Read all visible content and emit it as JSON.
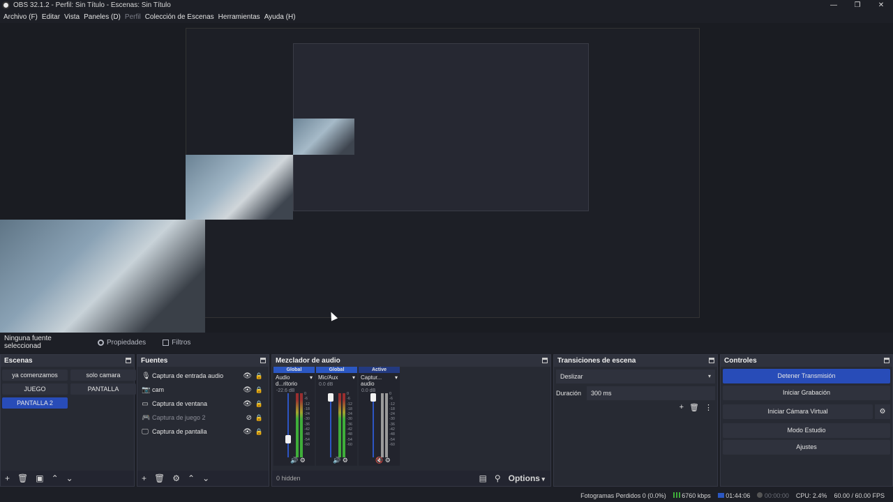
{
  "window": {
    "title": "OBS 32.1.2 - Perfil: Sin Título - Escenas: Sin Título",
    "min": "—",
    "max": "❐",
    "close": "✕"
  },
  "menu": [
    "Archivo (F)",
    "Editar",
    "Vista",
    "Paneles (D)",
    "Perfil",
    "Colección de Escenas",
    "Herramientas",
    "Ayuda (H)"
  ],
  "propbar": {
    "no_source": "Ninguna fuente seleccionad",
    "properties": "Propiedades",
    "filters": "Filtros"
  },
  "scenes": {
    "title": "Escenas",
    "items": [
      "ya comenzamos",
      "solo camara",
      "JUEGO",
      "PANTALLA",
      "PANTALLA 2"
    ],
    "active": "PANTALLA 2"
  },
  "sources": {
    "title": "Fuentes",
    "items": [
      {
        "label": "Captura de entrada audio",
        "icon": "mic-icon"
      },
      {
        "label": "cam",
        "icon": "camera-icon"
      },
      {
        "label": "Captura de ventana",
        "icon": "window-icon"
      },
      {
        "label": "Captura de juego 2",
        "icon": "gamepad-icon",
        "hidden": true
      },
      {
        "label": "Captura de pantalla",
        "icon": "monitor-icon"
      }
    ]
  },
  "mixer": {
    "title": "Mezclador de audio",
    "hidden": "0 hidden",
    "options": "Options",
    "channels": [
      {
        "tag": "Global",
        "name": "Audio d...ritorio",
        "db": "-22.6 dB"
      },
      {
        "tag": "Global",
        "name": "Mic/Aux",
        "db": "0.0 dB"
      },
      {
        "tag": "Active",
        "name": "Captur... audio",
        "db": "0.0 dB"
      }
    ],
    "scale": [
      "0",
      "-6",
      "-12",
      "-18",
      "-24",
      "-30",
      "-36",
      "-42",
      "-48",
      "-54",
      "-60"
    ]
  },
  "transitions": {
    "title": "Transiciones de escena",
    "selected": "Deslizar",
    "duration_label": "Duración",
    "duration": "300 ms"
  },
  "controls": {
    "title": "Controles",
    "stop_stream": "Detener Transmisión",
    "start_record": "Iniciar Grabación",
    "virtual_cam": "Iniciar Cámara Virtual",
    "studio_mode": "Modo Estudio",
    "settings": "Ajustes"
  },
  "status": {
    "dropped": "Fotogramas Perdidos 0 (0.0%)",
    "bitrate": "6760 kbps",
    "live_time": "01:44:06",
    "rec_time": "00:00:00",
    "cpu": "CPU: 2.4%",
    "fps": "60.00 / 60.00 FPS"
  }
}
